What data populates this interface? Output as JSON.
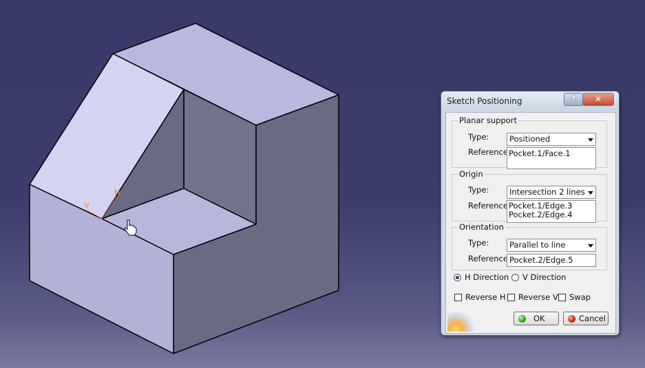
{
  "dialog": {
    "title": "Sketch Positioning",
    "help_label": "?",
    "close_label": "✕",
    "planar_support": {
      "legend": "Planar support",
      "type_label": "Type:",
      "type_value": "Positioned",
      "reference_label": "Reference:",
      "reference_value": "Pocket.1/Face.1"
    },
    "origin": {
      "legend": "Origin",
      "type_label": "Type:",
      "type_value": "Intersection 2 lines",
      "reference_label": "Reference:",
      "reference_values": [
        "Pocket.1/Edge.3",
        "Pocket.2/Edge.4"
      ]
    },
    "orientation": {
      "legend": "Orientation",
      "type_label": "Type:",
      "type_value": "Parallel to line",
      "reference_label": "Reference:",
      "reference_value": "Pocket.2/Edge.5"
    },
    "direction": {
      "h_label": "H Direction",
      "v_label": "V Direction",
      "selected": "H"
    },
    "options": {
      "reverse_h": "Reverse H",
      "reverse_v": "Reverse V",
      "swap": "Swap"
    },
    "ok_label": "OK",
    "cancel_label": "Cancel"
  },
  "viewport": {
    "axis_h_label": "H",
    "axis_v_label": "V"
  },
  "colors": {
    "background": "#3d3d6d",
    "part_top": "#b9b9df",
    "part_dark": "#6a6a82",
    "axis": "#ff7a2a"
  }
}
